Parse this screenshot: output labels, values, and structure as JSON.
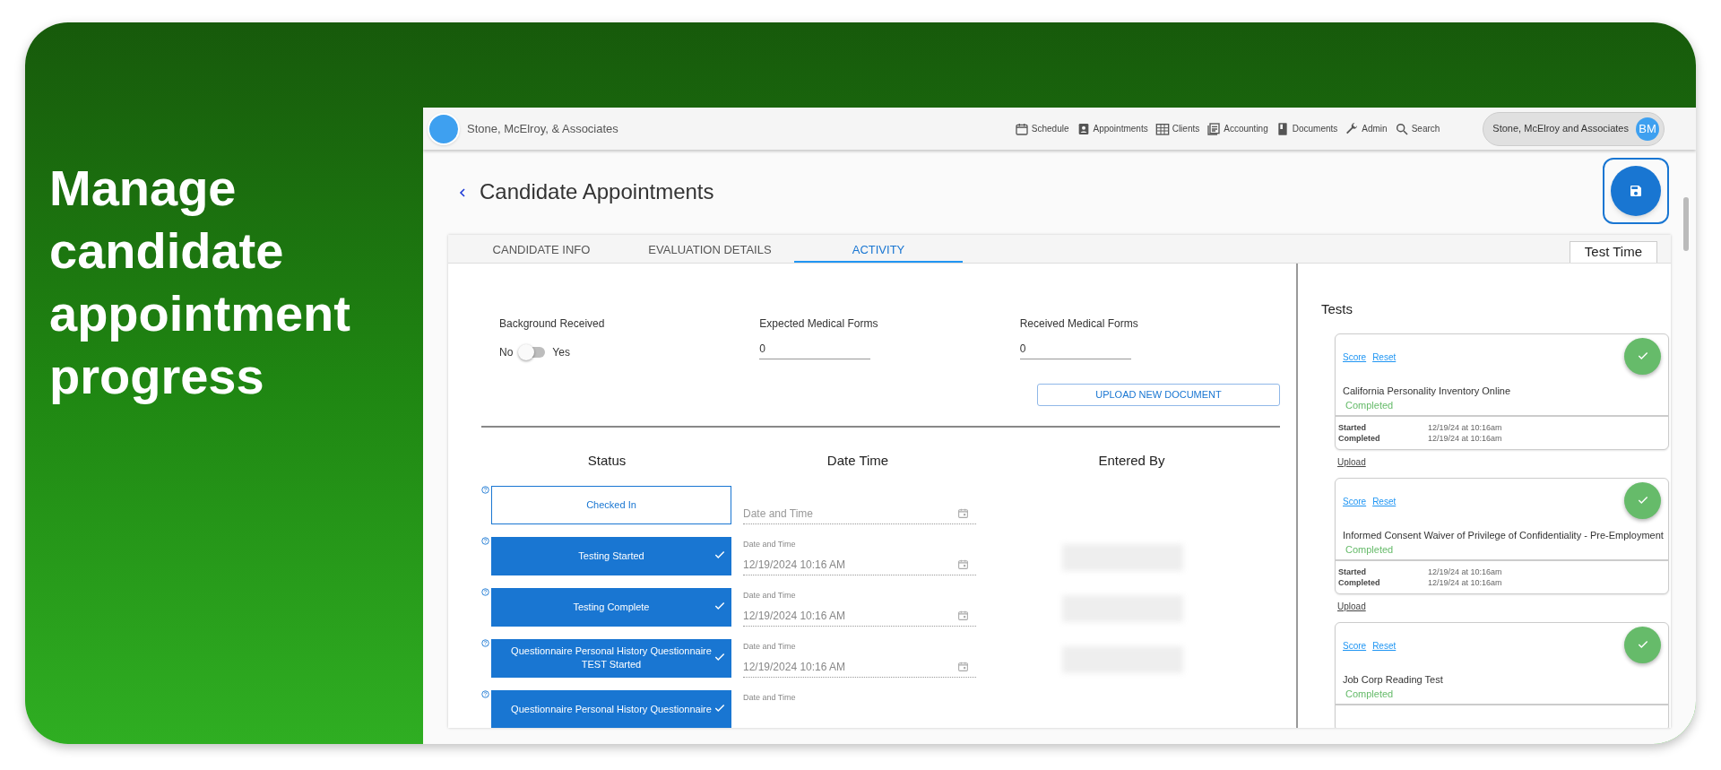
{
  "headline": "Manage candidate appointment progress",
  "app": {
    "company": "Stone, McElroy, & Associates",
    "nav": [
      {
        "kind": "calendar",
        "label": "Schedule"
      },
      {
        "kind": "badge",
        "label": "Appointments"
      },
      {
        "kind": "building",
        "label": "Clients"
      },
      {
        "kind": "ledger",
        "label": "Accounting"
      },
      {
        "kind": "book",
        "label": "Documents"
      },
      {
        "kind": "wrench",
        "label": "Admin"
      },
      {
        "kind": "search",
        "label": "Search"
      }
    ],
    "account": {
      "name": "Stone, McElroy and Associates",
      "initials": "BM"
    }
  },
  "page_title": "Candidate Appointments",
  "tabs": [
    {
      "label": "CANDIDATE INFO",
      "selected": false
    },
    {
      "label": "EVALUATION DETAILS",
      "selected": false
    },
    {
      "label": "ACTIVITY",
      "selected": true
    }
  ],
  "test_time_tab": "Test Time",
  "form": {
    "background_received": {
      "label": "Background Received",
      "off_label": "No",
      "on_label": "Yes",
      "on": false
    },
    "expected_medical_forms": {
      "label": "Expected Medical Forms",
      "value": "0"
    },
    "received_medical_forms": {
      "label": "Received Medical Forms",
      "value": "0"
    },
    "upload_button": "UPLOAD NEW DOCUMENT"
  },
  "status_table": {
    "columns": [
      "Status",
      "Date Time",
      "Entered By"
    ],
    "rows": [
      {
        "status": "Checked In",
        "done": false,
        "date_placeholder": "Date and Time"
      },
      {
        "status": "Testing Started",
        "done": true,
        "date_label": "Date and Time",
        "date_value": "12/19/2024 10:16 AM"
      },
      {
        "status": "Testing Complete",
        "done": true,
        "date_label": "Date and Time",
        "date_value": "12/19/2024 10:16 AM"
      },
      {
        "status": "Questionnaire Personal History Questionnaire TEST Started",
        "done": true,
        "date_label": "Date and Time",
        "date_value": "12/19/2024 10:16 AM"
      },
      {
        "status": "Questionnaire Personal History Questionnaire",
        "done": true,
        "date_label": "Date and Time"
      }
    ]
  },
  "tests": {
    "title": "Tests",
    "items": [
      {
        "score": "Score",
        "reset": "Reset",
        "name": "California Personality Inventory Online",
        "status": "Completed",
        "details": [
          {
            "label": "Started",
            "value": "12/19/24 at 10:16am"
          },
          {
            "label": "Completed",
            "value": "12/19/24 at 10:16am"
          }
        ],
        "upload": "Upload"
      },
      {
        "score": "Score",
        "reset": "Reset",
        "name": "Informed Consent Waiver of Privilege of Confidentiality - Pre-Employment",
        "status": "Completed",
        "details": [
          {
            "label": "Started",
            "value": "12/19/24 at 10:16am"
          },
          {
            "label": "Completed",
            "value": "12/19/24 at 10:16am"
          }
        ],
        "upload": "Upload"
      },
      {
        "score": "Score",
        "reset": "Reset",
        "name": "Job Corp Reading Test",
        "status": "Completed"
      }
    ]
  }
}
